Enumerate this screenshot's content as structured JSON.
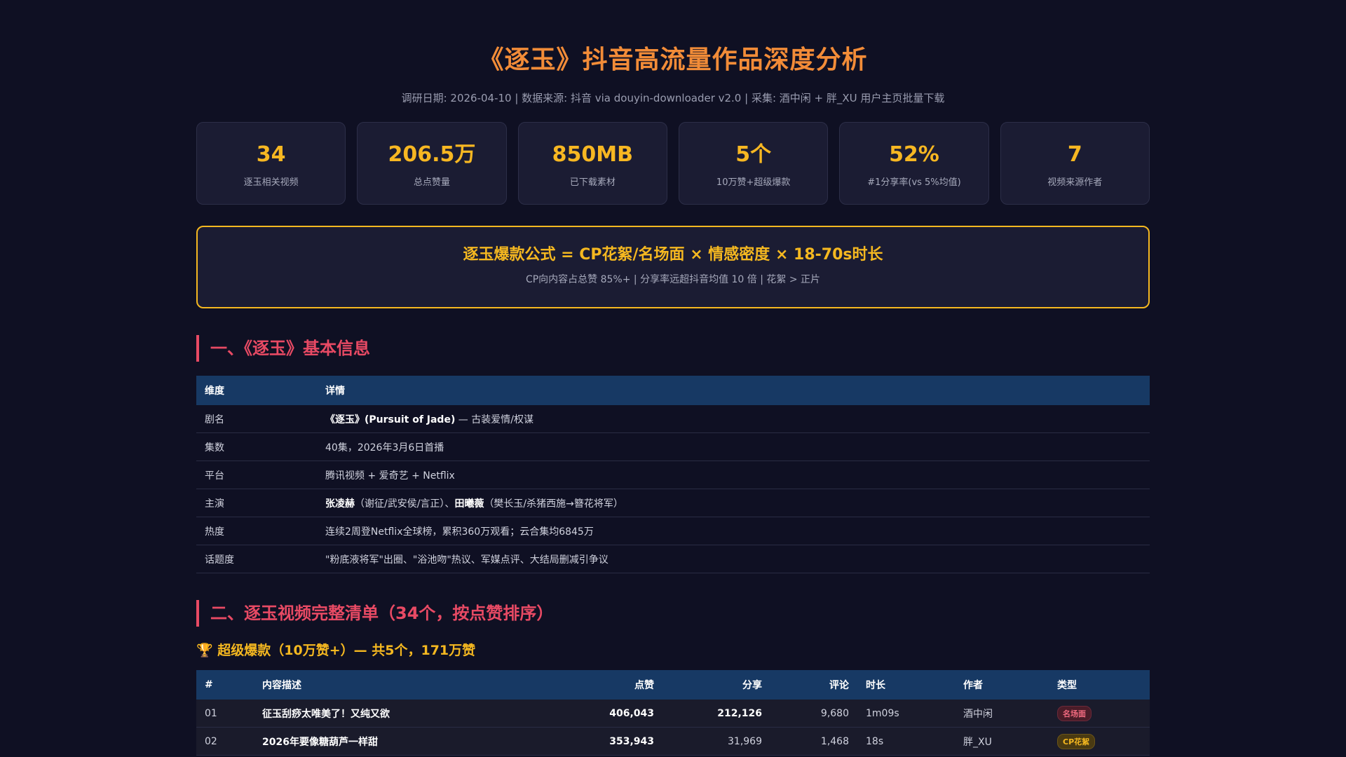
{
  "header": {
    "title": "《逐玉》抖音高流量作品深度分析",
    "subtitle": "调研日期: 2026-04-10 | 数据来源: 抖音 via douyin-downloader v2.0 | 采集: 酒中闲 + 胖_XU 用户主页批量下载"
  },
  "stats": [
    {
      "value": "34",
      "label": "逐玉相关视频"
    },
    {
      "value": "206.5万",
      "label": "总点赞量"
    },
    {
      "value": "850MB",
      "label": "已下载素材"
    },
    {
      "value": "5个",
      "label": "10万赞+超级爆款"
    },
    {
      "value": "52%",
      "label": "#1分享率(vs 5%均值)"
    },
    {
      "value": "7",
      "label": "视频来源作者"
    }
  ],
  "formula": {
    "title": "逐玉爆款公式 = CP花絮/名场面 × 情感密度 × 18-70s时长",
    "sub": "CP向内容占总赞 85%+ | 分享率远超抖音均值 10 倍 | 花絮 > 正片"
  },
  "section1": {
    "heading": "一、《逐玉》基本信息",
    "columns": [
      "维度",
      "详情"
    ],
    "rows": [
      {
        "dim": "剧名",
        "bold": "《逐玉》(Pursuit of Jade)",
        "text": " — 古装爱情/权谋"
      },
      {
        "dim": "集数",
        "text": "40集，2026年3月6日首播"
      },
      {
        "dim": "平台",
        "text": "腾讯视频 + 爱奇艺 + Netflix"
      },
      {
        "dim": "主演",
        "bold": "张凌赫",
        "text": "（谢征/武安侯/言正）、",
        "bold2": "田曦薇",
        "text2": "（樊长玉/杀猪西施→簪花将军）"
      },
      {
        "dim": "热度",
        "text": "连续2周登Netflix全球榜，累积360万观看；云合集均6845万"
      },
      {
        "dim": "话题度",
        "text": "\"粉底液将军\"出圈、\"浴池吻\"热议、军媒点评、大结局删减引争议"
      }
    ]
  },
  "section2": {
    "heading": "二、逐玉视频完整清单（34个，按点赞排序）",
    "subheading": "🏆 超级爆款（10万赞+）— 共5个，171万赞",
    "columns": [
      "#",
      "内容描述",
      "点赞",
      "分享",
      "评论",
      "时长",
      "作者",
      "类型"
    ],
    "rows": [
      {
        "idx": "01",
        "desc": "征玉刮痧太唯美了！又纯又欲",
        "likes": "406,043",
        "shares": "212,126",
        "comments": "9,680",
        "duration": "1m09s",
        "author": "酒中闲",
        "type": "名场面",
        "badge": "red"
      },
      {
        "idx": "02",
        "desc": "2026年要像糖葫芦一样甜",
        "likes": "353,943",
        "shares": "31,969",
        "comments": "1,468",
        "duration": "18s",
        "author": "胖_XU",
        "type": "CP花絮",
        "badge": "gold"
      }
    ]
  },
  "colors": {
    "background": "#0f1023",
    "title": "#f28c38",
    "accent": "#f5b820",
    "section": "#e84a64",
    "table_header": "#173964"
  }
}
